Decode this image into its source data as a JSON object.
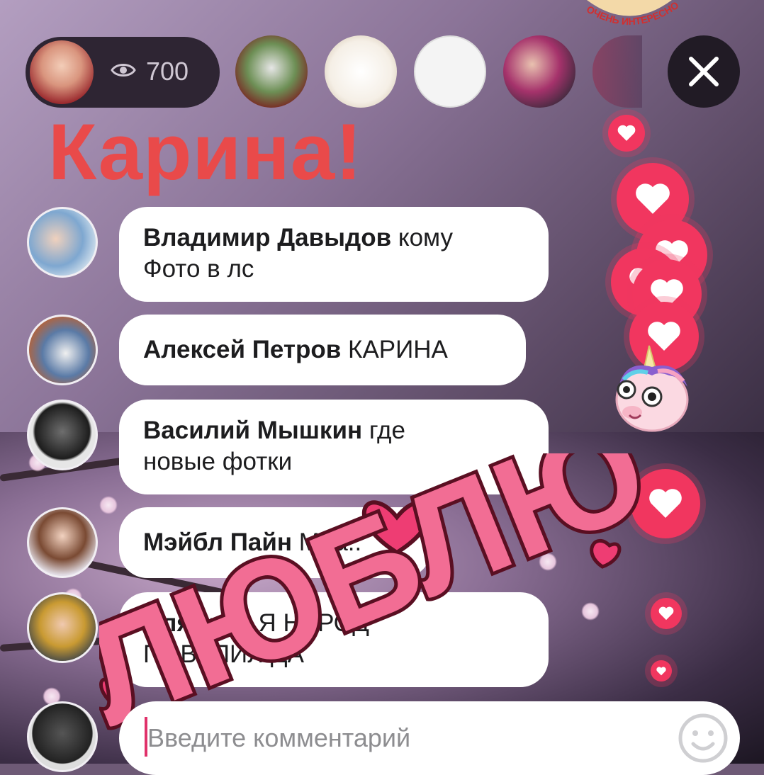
{
  "header": {
    "viewer_count": "700",
    "badge_text": "ОЧЕНЬ ИНТЕРЕСНО"
  },
  "title": "Карина!",
  "comments": [
    {
      "author": "Владимир Давыдов",
      "text_line1": " кому",
      "text_line2": "Фото в лс"
    },
    {
      "author": "Алексей Петров",
      "text_line1": " КАРИНА",
      "text_line2": ""
    },
    {
      "author": "Василий Мышкин",
      "text_line1": " где",
      "text_line2": "новые фотки"
    },
    {
      "author": "Мэйбл Пайн",
      "text_line1": " Мда..",
      "text_line2": ""
    },
    {
      "author": "Пляжник",
      "text_line1": " Я НАРОД",
      "text_line2": "ПОВЕЛИЛ ДА"
    }
  ],
  "sticker": {
    "text": "ЛЮБЛЮ"
  },
  "input": {
    "placeholder": "Введите комментарий"
  },
  "colors": {
    "accent_red": "#e94a4a",
    "heart_pink": "#f1365f",
    "sticker_pink": "#ee3d73"
  }
}
